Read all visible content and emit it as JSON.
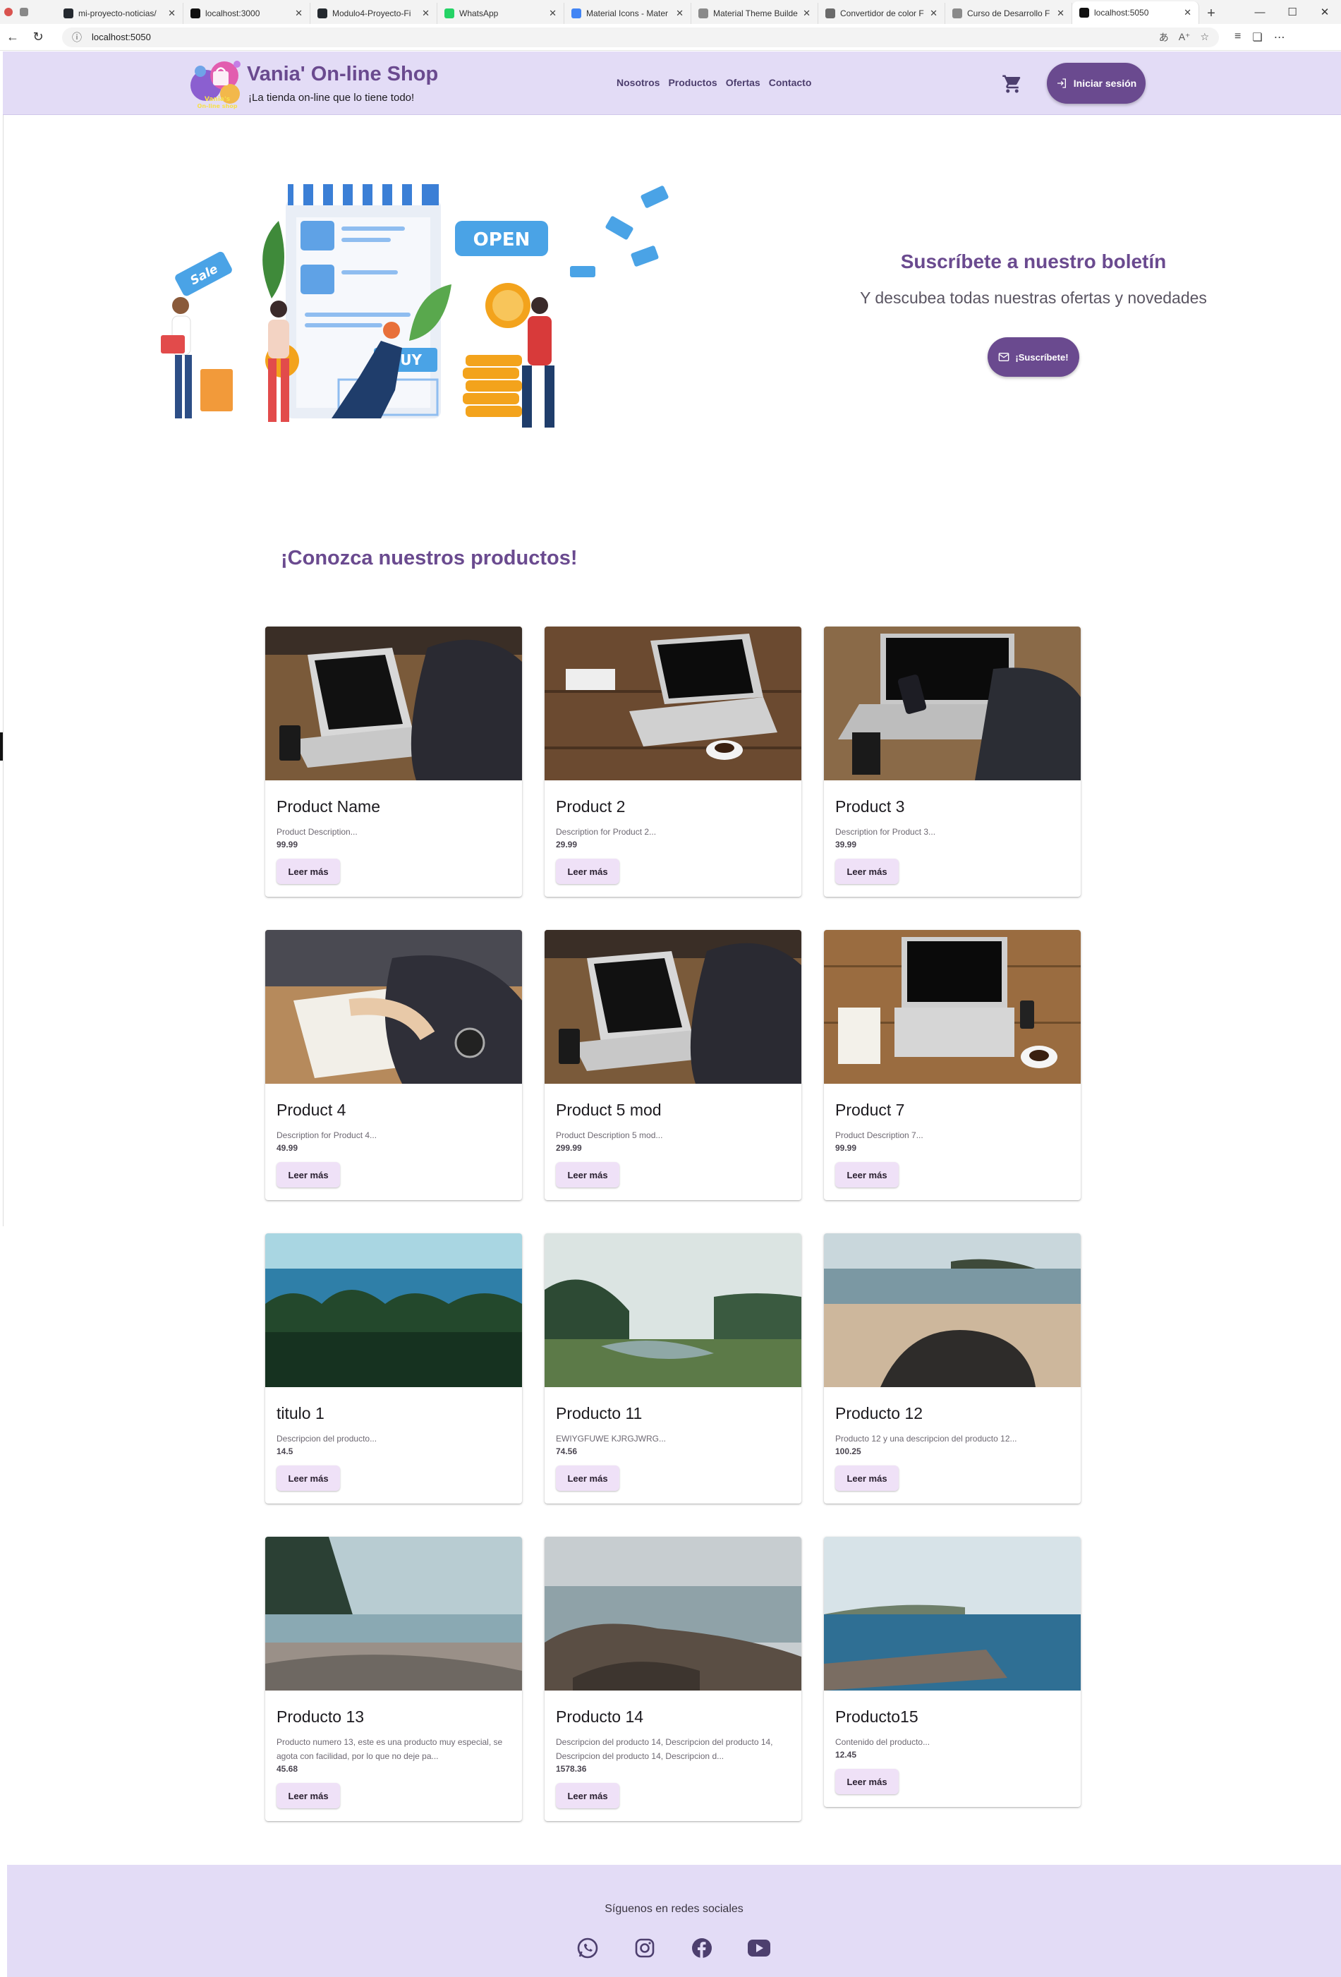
{
  "browser": {
    "tabs": [
      {
        "title": "mi-proyecto-noticias/",
        "favicon_color": "#24292f"
      },
      {
        "title": "localhost:3000",
        "favicon_color": "#111111"
      },
      {
        "title": "Modulo4-Proyecto-Fi",
        "favicon_color": "#24292f"
      },
      {
        "title": "WhatsApp",
        "favicon_color": "#25d366"
      },
      {
        "title": "Material Icons - Mater",
        "favicon_color": "#4285f4"
      },
      {
        "title": "Material Theme Builde",
        "favicon_color": "#8a8a8a"
      },
      {
        "title": "Convertidor de color F",
        "favicon_color": "#6a6a6a"
      },
      {
        "title": "Curso de Desarrollo F",
        "favicon_color": "#8a8a8a"
      },
      {
        "title": "localhost:5050",
        "favicon_color": "#111111",
        "active": true
      }
    ],
    "url": "localhost:5050",
    "window_buttons": [
      "—",
      "☐",
      "✕"
    ]
  },
  "header": {
    "brand_title": "Vania' On-line Shop",
    "brand_subtitle": "¡La tienda on-line que lo tiene todo!",
    "nav": [
      "Nosotros",
      "Productos",
      "Ofertas",
      "Contacto"
    ],
    "login_label": "Iniciar sesión"
  },
  "hero": {
    "newsletter_title": "Suscríbete a nuestro boletín",
    "newsletter_sub": "Y descubea todas nuestras ofertas y novedades",
    "subscribe_label": "¡Suscríbete!",
    "illustration_text": {
      "sale": "Sale",
      "open": "OPEN",
      "buy": "BUY"
    }
  },
  "products_title": "¡Conozca nuestros productos!",
  "products": [
    {
      "name": "Product Name",
      "description": "Product Description...",
      "price": "99.99",
      "read_more": "Leer más",
      "photo": "laptop-typing"
    },
    {
      "name": "Product 2",
      "description": "Description for Product 2...",
      "price": "29.99",
      "read_more": "Leer más",
      "photo": "laptop-coffee"
    },
    {
      "name": "Product 3",
      "description": "Description for Product 3...",
      "price": "39.99",
      "read_more": "Leer más",
      "photo": "laptop-phone"
    },
    {
      "name": "Product 4",
      "description": "Description for Product 4...",
      "price": "49.99",
      "read_more": "Leer más",
      "photo": "notebook-writing"
    },
    {
      "name": "Product 5 mod",
      "description": "Product Description 5 mod...",
      "price": "299.99",
      "read_more": "Leer más",
      "photo": "laptop-typing"
    },
    {
      "name": "Product 7",
      "description": "Product Description 7...",
      "price": "99.99",
      "read_more": "Leer más",
      "photo": "laptop-top"
    },
    {
      "name": "titulo 1",
      "description": "Descripcion del producto...",
      "price": "14.5",
      "read_more": "Leer más",
      "photo": "forest-lake"
    },
    {
      "name": "Producto 11",
      "description": "EWIYGFUWE KJRGJWRG...",
      "price": "74.56",
      "read_more": "Leer más",
      "photo": "valley"
    },
    {
      "name": "Producto 12",
      "description": "Producto 12 y una descripcion del producto 12...",
      "price": "100.25",
      "read_more": "Leer más",
      "photo": "beach-rocks"
    },
    {
      "name": "Producto 13",
      "description": "Producto numero 13, este es una producto muy especial, se agota con facilidad, por lo que no deje pa...",
      "price": "45.68",
      "read_more": "Leer más",
      "photo": "shore-trees"
    },
    {
      "name": "Producto 14",
      "description": "Descripcion del producto 14, Descripcion del producto 14, Descripcion del producto 14, Descripcion d...",
      "price": "1578.36",
      "read_more": "Leer más",
      "photo": "rocky-sea"
    },
    {
      "name": "Producto15",
      "description": "Contenido del producto...",
      "price": "12.45",
      "read_more": "Leer más",
      "photo": "sea-log"
    }
  ],
  "footer": {
    "follow_label": "Síguenos en redes sociales",
    "socials": [
      "whatsapp-icon",
      "instagram-icon",
      "facebook-icon",
      "youtube-icon"
    ]
  },
  "colors": {
    "primary": "#6a4a8f",
    "header_bg": "#e3dcf6",
    "button_tonal": "#efe1f7"
  }
}
